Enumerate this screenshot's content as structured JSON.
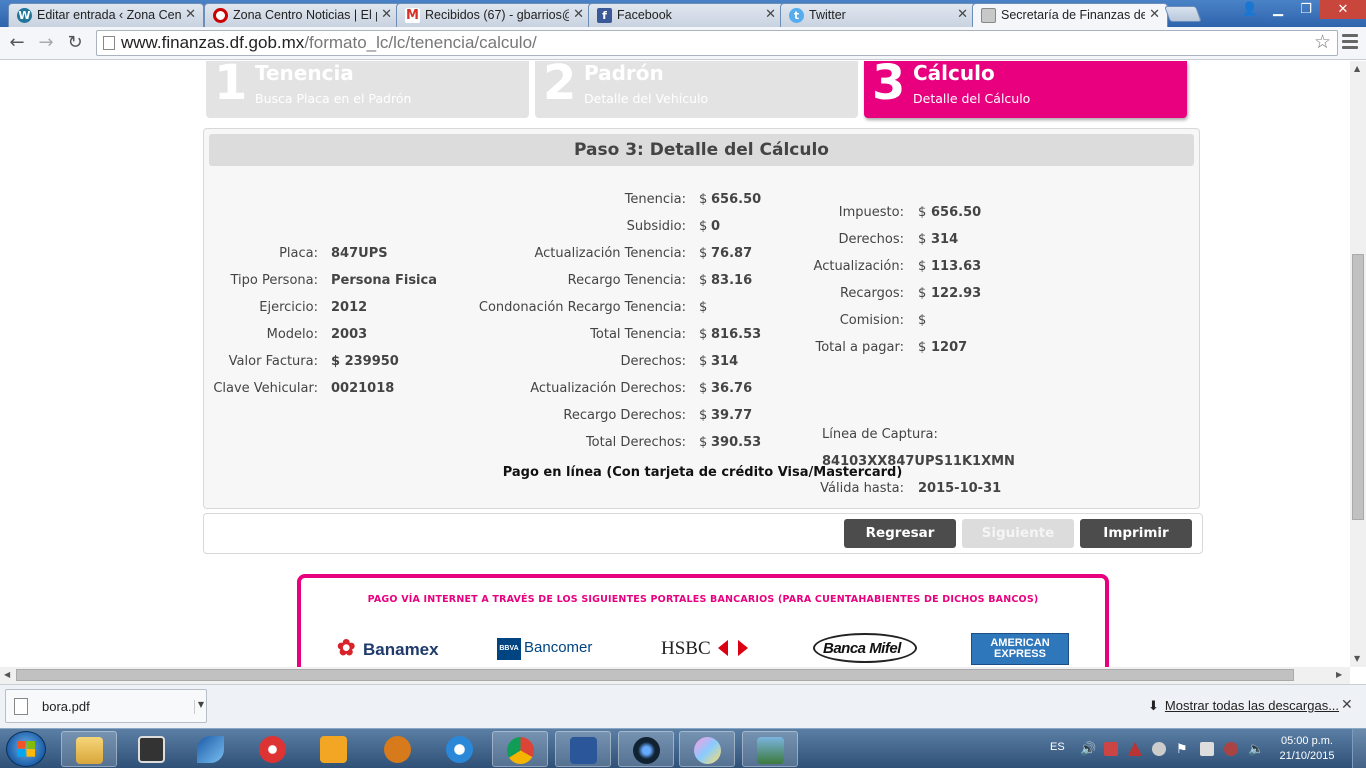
{
  "browser": {
    "tabs": [
      {
        "title": "Editar entrada ‹ Zona Centro",
        "icon": "wordpress-icon",
        "active": false
      },
      {
        "title": "Zona Centro Noticias | El portal",
        "icon": "zona-centro-icon",
        "active": false
      },
      {
        "title": "Recibidos (67) - gbarrios@",
        "icon": "gmail-icon",
        "active": false
      },
      {
        "title": "Facebook",
        "icon": "facebook-icon",
        "active": false
      },
      {
        "title": "Twitter",
        "icon": "twitter-icon",
        "active": false
      },
      {
        "title": "Secretaría de Finanzas del",
        "icon": "finanzas-icon",
        "active": true
      }
    ],
    "url_host": "www.finanzas.df.gob.mx",
    "url_path": "/formato_lc/lc/tenencia/calculo/"
  },
  "steps": [
    {
      "number": "1",
      "title": "Tenencia",
      "subtitle": "Busca Placa en el Padrón"
    },
    {
      "number": "2",
      "title": "Padrón",
      "subtitle": "Detalle del Vehículo"
    },
    {
      "number": "3",
      "title": "Cálculo",
      "subtitle": "Detalle del Cálculo"
    }
  ],
  "detail": {
    "heading": "Paso 3: Detalle del Cálculo",
    "vehicle": [
      {
        "label": "Placa:",
        "value": "847UPS"
      },
      {
        "label": "Tipo Persona:",
        "value": "Persona Fisica"
      },
      {
        "label": "Ejercicio:",
        "value": "2012"
      },
      {
        "label": "Modelo:",
        "value": "2003"
      },
      {
        "label": "Valor Factura:",
        "value": "$ 239950"
      },
      {
        "label": "Clave Vehicular:",
        "value": "0021018"
      }
    ],
    "breakdown": [
      {
        "label": "Tenencia:",
        "currency": "$",
        "value": "656.50"
      },
      {
        "label": "Subsidio:",
        "currency": "$",
        "value": "0"
      },
      {
        "label": "Actualización Tenencia:",
        "currency": "$",
        "value": "76.87"
      },
      {
        "label": "Recargo Tenencia:",
        "currency": "$",
        "value": "83.16"
      },
      {
        "label": "Condonación Recargo Tenencia:",
        "currency": "$",
        "value": ""
      },
      {
        "label": "Total Tenencia:",
        "currency": "$",
        "value": "816.53"
      },
      {
        "label": "Derechos:",
        "currency": "$",
        "value": "314"
      },
      {
        "label": "Actualización Derechos:",
        "currency": "$",
        "value": "36.76"
      },
      {
        "label": "Recargo Derechos:",
        "currency": "$",
        "value": "39.77"
      },
      {
        "label": "Total Derechos:",
        "currency": "$",
        "value": "390.53"
      }
    ],
    "summary": [
      {
        "label": "Impuesto:",
        "currency": "$",
        "value": "656.50"
      },
      {
        "label": "Derechos:",
        "currency": "$",
        "value": "314"
      },
      {
        "label": "Actualización:",
        "currency": "$",
        "value": "113.63"
      },
      {
        "label": "Recargos:",
        "currency": "$",
        "value": "122.93"
      },
      {
        "label": "Comision:",
        "currency": "$",
        "value": ""
      },
      {
        "label": "Total a pagar:",
        "currency": "$",
        "value": "1207"
      }
    ],
    "capture_label": "Línea de Captura:",
    "capture_value": "84103XX847UPS11K1XMN",
    "valid_label": "Válida hasta:",
    "valid_value": "2015-10-31",
    "pay_online": "Pago en línea (Con tarjeta de crédito Visa/Mastercard)"
  },
  "buttons": {
    "back": "Regresar",
    "next": "Siguiente",
    "print": "Imprimir"
  },
  "banks": {
    "title": "PAGO VÍA INTERNET A TRAVÉS DE LOS SIGUIENTES PORTALES BANCARIOS (PARA CUENTAHABIENTES DE DICHOS BANCOS)",
    "list": [
      "Banamex",
      "Bancomer",
      "HSBC",
      "Banca Mifel",
      "AMERICAN EXPRESS"
    ],
    "bbva": "BBVA"
  },
  "downloads": {
    "file": "bora.pdf",
    "show_all": "Mostrar todas las descargas..."
  },
  "taskbar": {
    "lang": "ES",
    "time": "05:00 p.m.",
    "date": "21/10/2015"
  },
  "colors": {
    "accent": "#e8007f",
    "button_dark": "#4c4c4c",
    "button_disabled": "#dcdcdc"
  }
}
